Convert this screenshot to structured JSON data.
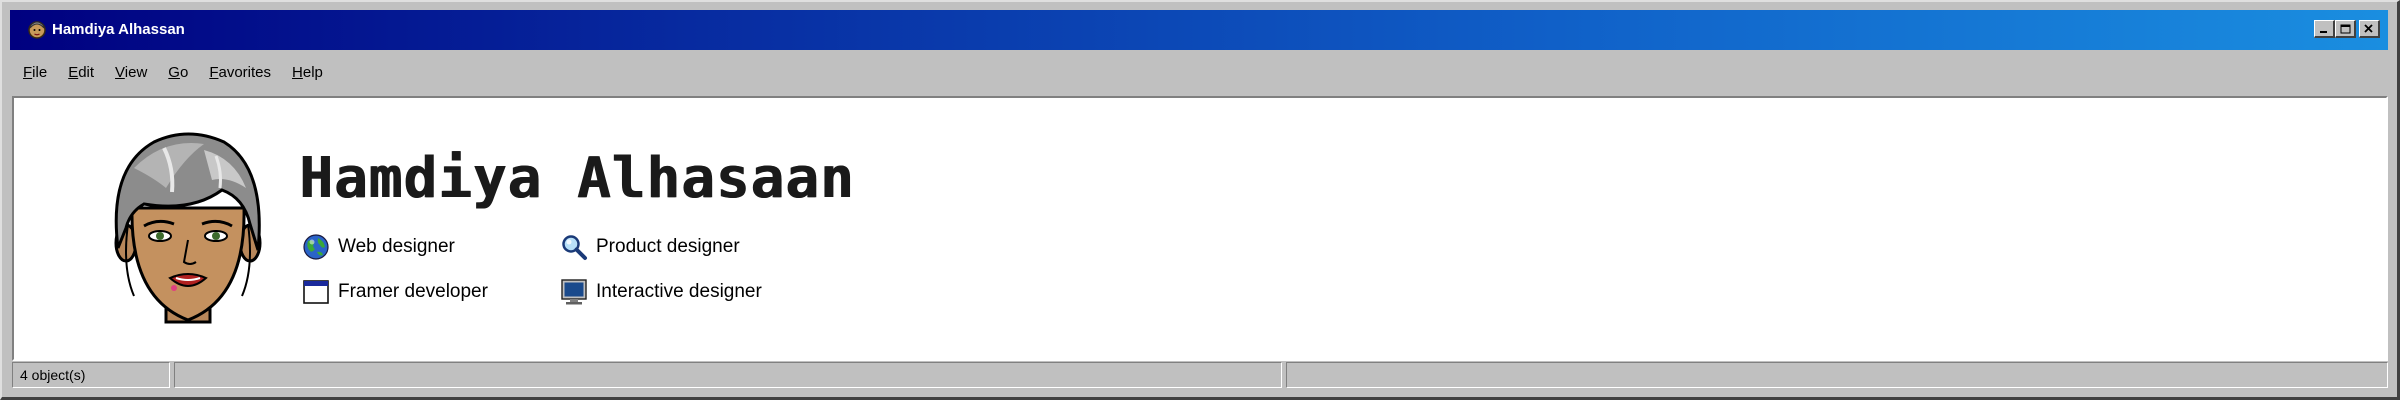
{
  "window": {
    "title": "Hamdiya Alhassan"
  },
  "menu": {
    "items": [
      "File",
      "Edit",
      "View",
      "Go",
      "Favorites",
      "Help"
    ]
  },
  "profile": {
    "name": "Hamdiya Alhasaan",
    "roles": [
      {
        "label": "Web designer",
        "icon": "globe-icon"
      },
      {
        "label": "Product designer",
        "icon": "magnifier-icon"
      },
      {
        "label": "Framer developer",
        "icon": "window-icon"
      },
      {
        "label": "Interactive designer",
        "icon": "monitor-icon"
      }
    ]
  },
  "status": {
    "objects": "4 object(s)",
    "panel2": "",
    "panel3": ""
  },
  "colors": {
    "titlebar_start": "#000080",
    "titlebar_end": "#1a8ee0",
    "chrome": "#c0c0c0"
  }
}
